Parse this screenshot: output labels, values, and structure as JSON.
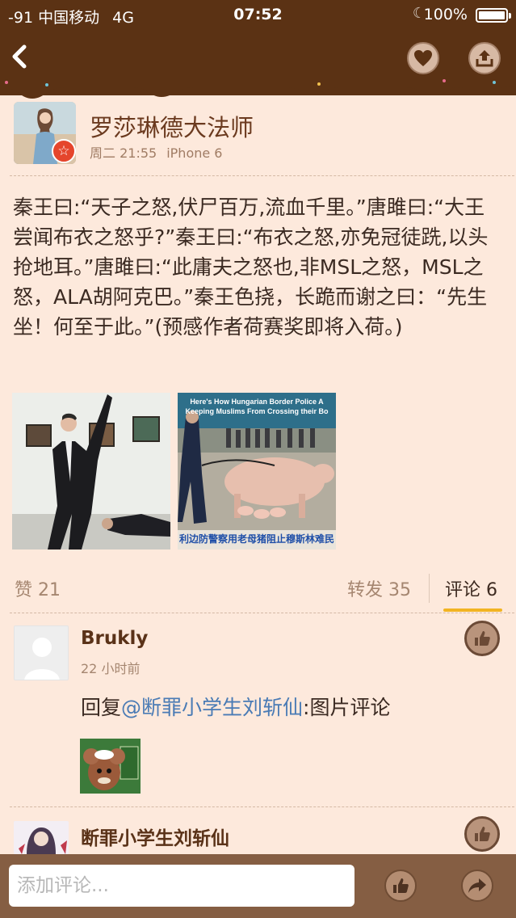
{
  "status_bar": {
    "carrier": "-91 中国移动",
    "network": "4G",
    "time": "07:52",
    "battery": "100%"
  },
  "post": {
    "user_name": "罗莎琳德大法师",
    "time": "周二 21:55",
    "device": "iPhone 6",
    "text": "秦王曰:“天子之怒,伏尸百万,流血千里。”唐雎曰:“大王尝闻布衣之怒乎?”秦王曰:“布衣之怒,亦免冠徒跣,以头抢地耳。”唐雎曰:“此庸夫之怒也,非MSL之怒，MSL之怒，ALA胡阿克巴。”秦王色挠，长跪而谢之曰：“先生坐！何至于此。”(预感作者荷赛奖即将入荷。)",
    "image2_caption_top_1": "Here's How Hungarian Border Police A",
    "image2_caption_top_2": "Keeping Muslims From Crossing their Bo",
    "image2_caption_bottom": "利边防警察用老母猪阻止穆斯林难民"
  },
  "stats": {
    "likes_label": "赞",
    "likes_count": "21",
    "reposts_label": "转发",
    "reposts_count": "35",
    "comments_label": "评论",
    "comments_count": "6"
  },
  "comments": [
    {
      "user_name": "Brukly",
      "time": "22 小时前",
      "reply_prefix": "回复",
      "mention": "@断罪小学生刘斩仙",
      "text": ":图片评论"
    },
    {
      "user_name": "断罪小学生刘斩仙"
    }
  ],
  "input": {
    "placeholder": "添加评论..."
  },
  "colors": {
    "header": "#5b3214",
    "background": "#fde9dc",
    "accent": "#f2b422",
    "link": "#4a7bb5",
    "bottom_bar": "#855e43"
  },
  "icons": [
    "back-icon",
    "heart-icon",
    "share-icon",
    "thumb-up-icon",
    "forward-icon",
    "star-badge-icon"
  ]
}
